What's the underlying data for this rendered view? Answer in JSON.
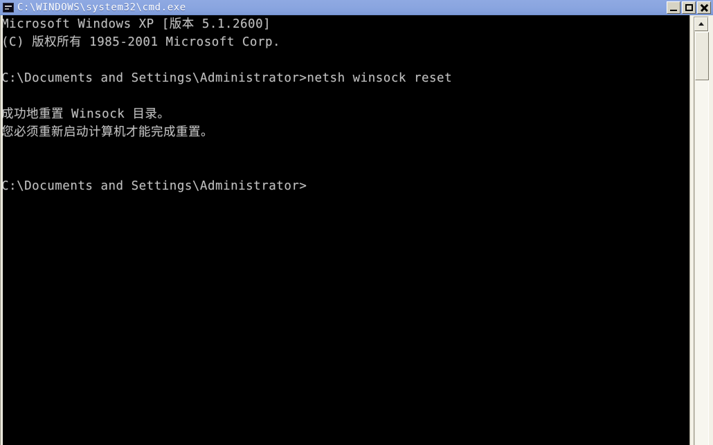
{
  "window": {
    "title": "C:\\WINDOWS\\system32\\cmd.exe",
    "icon": "cmd-console-icon",
    "titlebar_color": "#8ba6e0",
    "title_text_color": "#ffffff",
    "console_background": "#000000",
    "console_text_color": "#c0c0c0",
    "frame_color": "#ece9d8"
  },
  "window_buttons": {
    "minimize_label": "Minimize",
    "maximize_label": "Maximize",
    "close_label": "Close"
  },
  "console": {
    "lines": [
      "Microsoft Windows XP [版本 5.1.2600]",
      "(C) 版权所有 1985-2001 Microsoft Corp.",
      "",
      "C:\\Documents and Settings\\Administrator>netsh winsock reset",
      "",
      "成功地重置 Winsock 目录。",
      "您必须重新启动计算机才能完成重置。",
      "",
      "",
      "C:\\Documents and Settings\\Administrator>"
    ],
    "text": "Microsoft Windows XP [版本 5.1.2600]\n(C) 版权所有 1985-2001 Microsoft Corp.\n\nC:\\Documents and Settings\\Administrator>netsh winsock reset\n\n成功地重置 Winsock 目录。\n您必须重新启动计算机才能完成重置。\n\n\nC:\\Documents and Settings\\Administrator>",
    "banner_product": "Microsoft Windows XP",
    "banner_version": "版本 5.1.2600",
    "copyright": "(C) 版权所有 1985-2001 Microsoft Corp.",
    "prompt": "C:\\Documents and Settings\\Administrator>",
    "command": "netsh winsock reset",
    "output_line_1": "成功地重置 Winsock 目录。",
    "output_line_2": "您必须重新启动计算机才能完成重置。"
  },
  "scrollbar": {
    "up_arrow_label": "▲",
    "orientation": "vertical"
  }
}
